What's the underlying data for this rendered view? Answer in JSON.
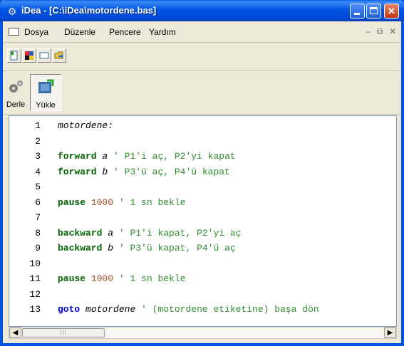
{
  "window": {
    "title": "iDea - [C:\\iDea\\motordene.bas]"
  },
  "menu": {
    "items": [
      "Dosya",
      "Düzenle",
      "Pencere",
      "Yardım"
    ]
  },
  "toolbar2": {
    "compile_label": "Derle",
    "upload_label": "Yükle"
  },
  "editor": {
    "lines": [
      {
        "n": "1",
        "parts": [
          {
            "t": "motordene:",
            "c": "label"
          }
        ]
      },
      {
        "n": "2",
        "parts": []
      },
      {
        "n": "3",
        "parts": [
          {
            "t": "forward",
            "c": "kw"
          },
          {
            "t": " ",
            "c": "plain"
          },
          {
            "t": "a",
            "c": "label"
          },
          {
            "t": " ' P1'i aç, P2'yi kapat",
            "c": "cm"
          }
        ]
      },
      {
        "n": "4",
        "parts": [
          {
            "t": "forward",
            "c": "kw"
          },
          {
            "t": " ",
            "c": "plain"
          },
          {
            "t": "b",
            "c": "label"
          },
          {
            "t": " ' P3'ü aç, P4'ü kapat",
            "c": "cm"
          }
        ]
      },
      {
        "n": "5",
        "parts": []
      },
      {
        "n": "6",
        "parts": [
          {
            "t": "pause",
            "c": "kw"
          },
          {
            "t": " ",
            "c": "plain"
          },
          {
            "t": "1000",
            "c": "num"
          },
          {
            "t": " ' 1 sn bekle",
            "c": "cm"
          }
        ]
      },
      {
        "n": "7",
        "parts": []
      },
      {
        "n": "8",
        "parts": [
          {
            "t": "backward",
            "c": "kw"
          },
          {
            "t": " ",
            "c": "plain"
          },
          {
            "t": "a",
            "c": "label"
          },
          {
            "t": " ' P1'i kapat, P2'yi aç",
            "c": "cm"
          }
        ]
      },
      {
        "n": "9",
        "parts": [
          {
            "t": "backward",
            "c": "kw"
          },
          {
            "t": " ",
            "c": "plain"
          },
          {
            "t": "b",
            "c": "label"
          },
          {
            "t": " ' P3'ü kapat, P4'ü aç",
            "c": "cm"
          }
        ]
      },
      {
        "n": "10",
        "parts": []
      },
      {
        "n": "11",
        "parts": [
          {
            "t": "pause",
            "c": "kw"
          },
          {
            "t": " ",
            "c": "plain"
          },
          {
            "t": "1000",
            "c": "num"
          },
          {
            "t": " ' 1 sn bekle",
            "c": "cm"
          }
        ]
      },
      {
        "n": "12",
        "parts": []
      },
      {
        "n": "13",
        "parts": [
          {
            "t": "goto",
            "c": "kwblue"
          },
          {
            "t": " ",
            "c": "plain"
          },
          {
            "t": "motordene",
            "c": "label"
          },
          {
            "t": " ' (motordene etiketine) başa dön",
            "c": "cm"
          }
        ]
      }
    ]
  },
  "colors": {
    "keyword": "#006400",
    "goto_keyword": "#0000cc",
    "number": "#a0522d",
    "comment": "#2e8b2e",
    "titlebar": "#0055e5"
  }
}
